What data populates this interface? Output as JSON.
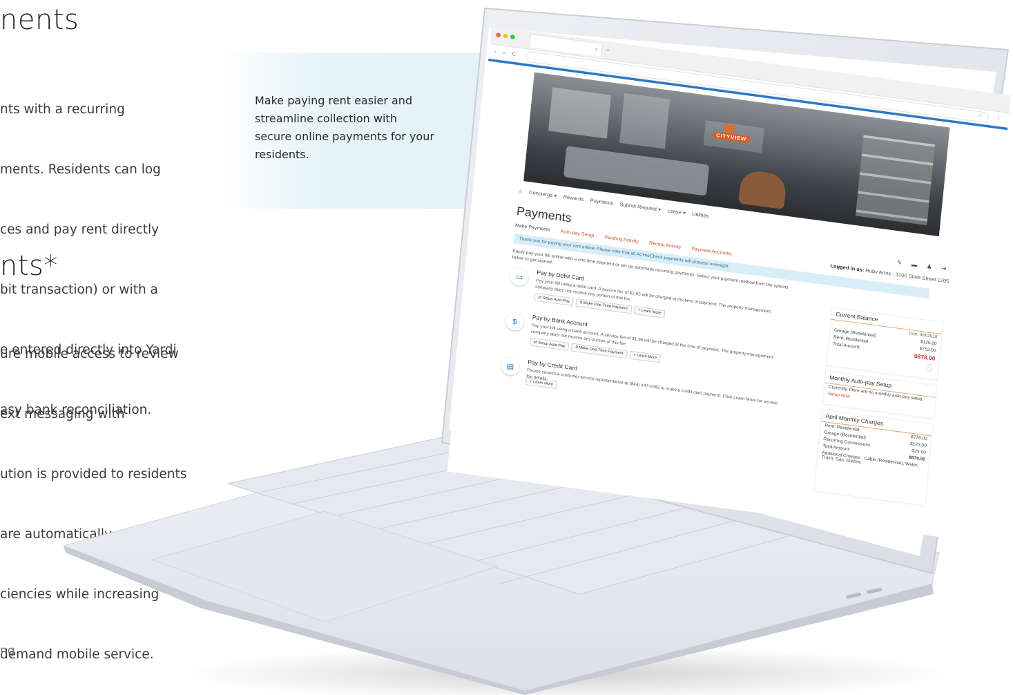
{
  "left_copy": {
    "heading1": "nents",
    "para1": [
      "nts with a recurring",
      "ments. Residents can log",
      "ces and pay rent directly",
      "bit transaction) or with a",
      "e entered directly into Yardi",
      "asy bank reconciliation."
    ],
    "heading2": "nts*",
    "para2": [
      "ure mobile access to review",
      "ext messaging with",
      "ution is provided to residents",
      "are automatically entered",
      "ciencies while increasing",
      "demand mobile service."
    ],
    "footer_fragment": "ng"
  },
  "callout": {
    "text": "Make paying rent easier and streamline collection with secure online payments for your residents."
  },
  "browser": {
    "tab_close": "×",
    "new_tab": "+",
    "nav_glyphs": "‹ › C",
    "star": "☆",
    "menu": "⋮"
  },
  "app": {
    "brand": "CITYVIEW",
    "nav": {
      "home": "⌂",
      "items": [
        "Concierge ▾",
        "Rewards",
        "Payments",
        "Submit Request ▾",
        "Lease ▾",
        "Utilities"
      ]
    },
    "page_title": "Payments",
    "tools": "✎ ▬ ♟ ⇥",
    "logged_label": "Logged in as:",
    "logged_value": "Ruby Arms - 3100 State Street 1205",
    "subtabs": [
      "Make Payments",
      "Auto-pay Setup",
      "Pending Activity",
      "Recent Activity",
      "Payment Accounts"
    ],
    "notice": "Thank you for paying your rent online! Please note that all ACH/eCheck payments will process overnight.",
    "intro": "Easily pay your bill online with a one time payment or set up automatic recurring payments. Select your payment method from the options below to get started.",
    "options": [
      {
        "icon": "▭",
        "title": "Pay by Debit Card",
        "desc": "Pay your bill using a debit card. A service fee of $2.95 will be charged at the time of payment. The property management company does not receive any portion of this fee.",
        "buttons": [
          "⇄ Setup Auto-Pay",
          "$ Make One-Time Payment",
          "+ Learn More"
        ]
      },
      {
        "icon": "$",
        "title": "Pay by Bank Account",
        "desc": "Pay your bill using a bank account. A service fee of $1.95 will be charged at the time of payment. The property management company does not receive any portion of this fee.",
        "buttons": [
          "⇄ Setup Auto-Pay",
          "$ Make One-Time Payment",
          "+ Learn More"
        ]
      },
      {
        "icon": "▤",
        "title": "Pay by Credit Card",
        "desc": "Please contact a customer service representative at (844) 447-0382 to make a credit card payment. Click Learn More for service fee details.",
        "buttons": [
          "+ Learn More"
        ]
      }
    ],
    "current_balance": {
      "title": "Current Balance",
      "due": "Due: 4/8/2018",
      "rows": [
        {
          "label": "Garage (Residential)",
          "value": "$125.00"
        },
        {
          "label": "Rent: Residential",
          "value": "$753.00"
        }
      ],
      "total_label": "Total Amount:",
      "total_value": "$878.00",
      "dollar": "$"
    },
    "autopay": {
      "title": "Monthly Auto-pay Setup",
      "text": "Currently, there are no monthly auto-pay setup.",
      "link": "Setup Now"
    },
    "monthly": {
      "title": "April Monthly Charges",
      "rows": [
        {
          "label": "Rent: Residential",
          "value": "$778.00"
        },
        {
          "label": "Garage (Residential)",
          "value": "$125.00"
        },
        {
          "label": "Recurring Concessions",
          "value": "-$25.00"
        }
      ],
      "total_label": "Total Amount:",
      "total_value": "$878.00",
      "additional": "Additional Charges : Cable (Residential), Water, Trash, Gas, Electric"
    }
  }
}
